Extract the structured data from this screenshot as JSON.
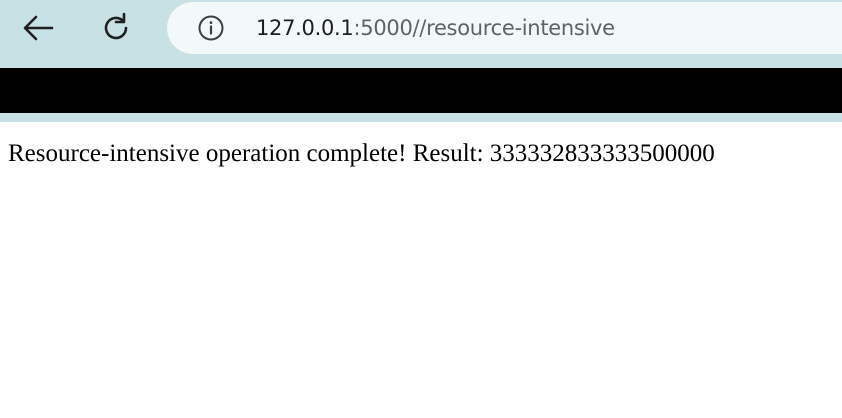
{
  "browser": {
    "address_bar": {
      "host": "127.0.0.1",
      "rest": ":5000//resource-intensive"
    },
    "icons": {
      "back": "arrow-left-icon",
      "reload": "reload-icon",
      "site_info": "info-icon"
    },
    "colors": {
      "toolbar": "#c7e1e5",
      "omnibox": "#f3f8f9",
      "bar": "#000000"
    }
  },
  "page": {
    "message": "Resource-intensive operation complete! Result: 333332833333500000"
  }
}
